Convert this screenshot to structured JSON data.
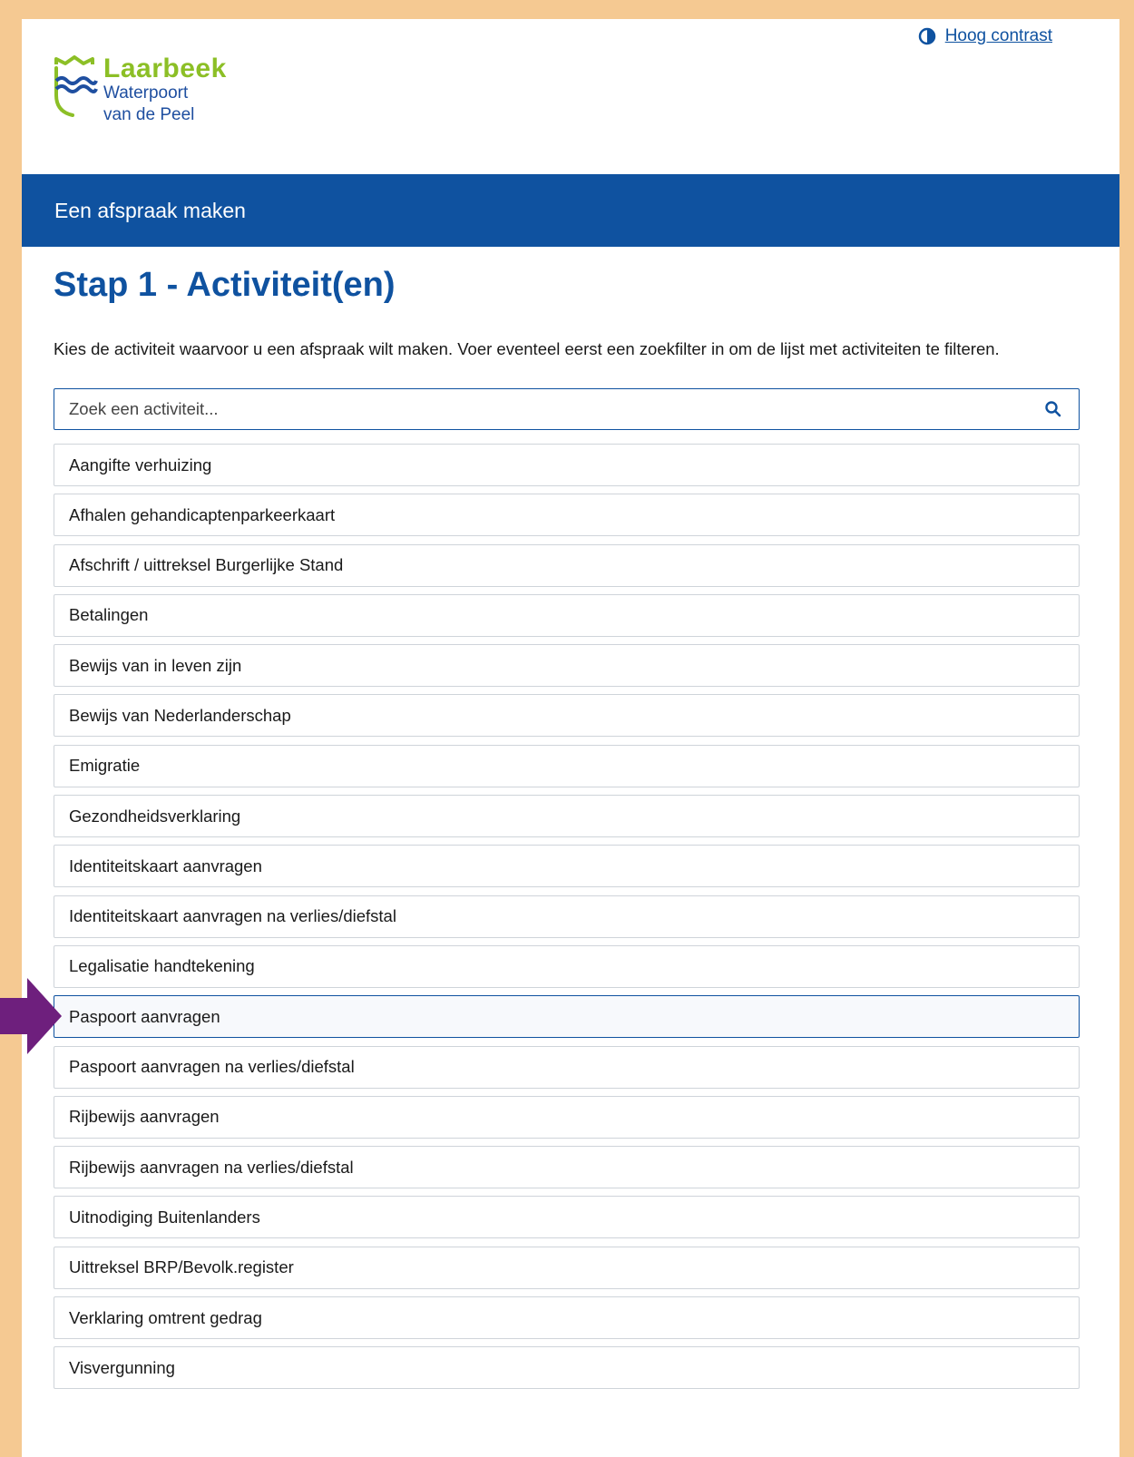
{
  "colors": {
    "accent": "#0f52a0",
    "logo_green": "#8cbf26",
    "frame": "#f5c992",
    "pointer_arrow": "#6e1f7d"
  },
  "header": {
    "contrast_label": "Hoog contrast",
    "logo": {
      "name": "Laarbeek",
      "line1": "Waterpoort",
      "line2": "van de Peel"
    }
  },
  "banner": {
    "title": "Een afspraak maken"
  },
  "main": {
    "heading": "Stap 1 - Activiteit(en)",
    "intro": "Kies de activiteit waarvoor u een afspraak wilt maken. Voer eventeel eerst een zoekfilter in om de lijst met activiteiten te filteren.",
    "search": {
      "placeholder": "Zoek een activiteit...",
      "icon": "search-icon"
    },
    "activities": [
      "Aangifte verhuizing",
      "Afhalen gehandicaptenparkeerkaart",
      "Afschrift / uittreksel Burgerlijke Stand",
      "Betalingen",
      "Bewijs van in leven zijn",
      "Bewijs van Nederlanderschap",
      "Emigratie",
      "Gezondheidsverklaring",
      "Identiteitskaart aanvragen",
      "Identiteitskaart aanvragen na verlies/diefstal",
      "Legalisatie handtekening",
      "Paspoort aanvragen",
      "Paspoort aanvragen na verlies/diefstal",
      "Rijbewijs aanvragen",
      "Rijbewijs aanvragen na verlies/diefstal",
      "Uitnodiging Buitenlanders",
      "Uittreksel BRP/Bevolk.register",
      "Verklaring omtrent gedrag",
      "Visvergunning"
    ],
    "highlighted_activity": "Paspoort aanvragen"
  }
}
